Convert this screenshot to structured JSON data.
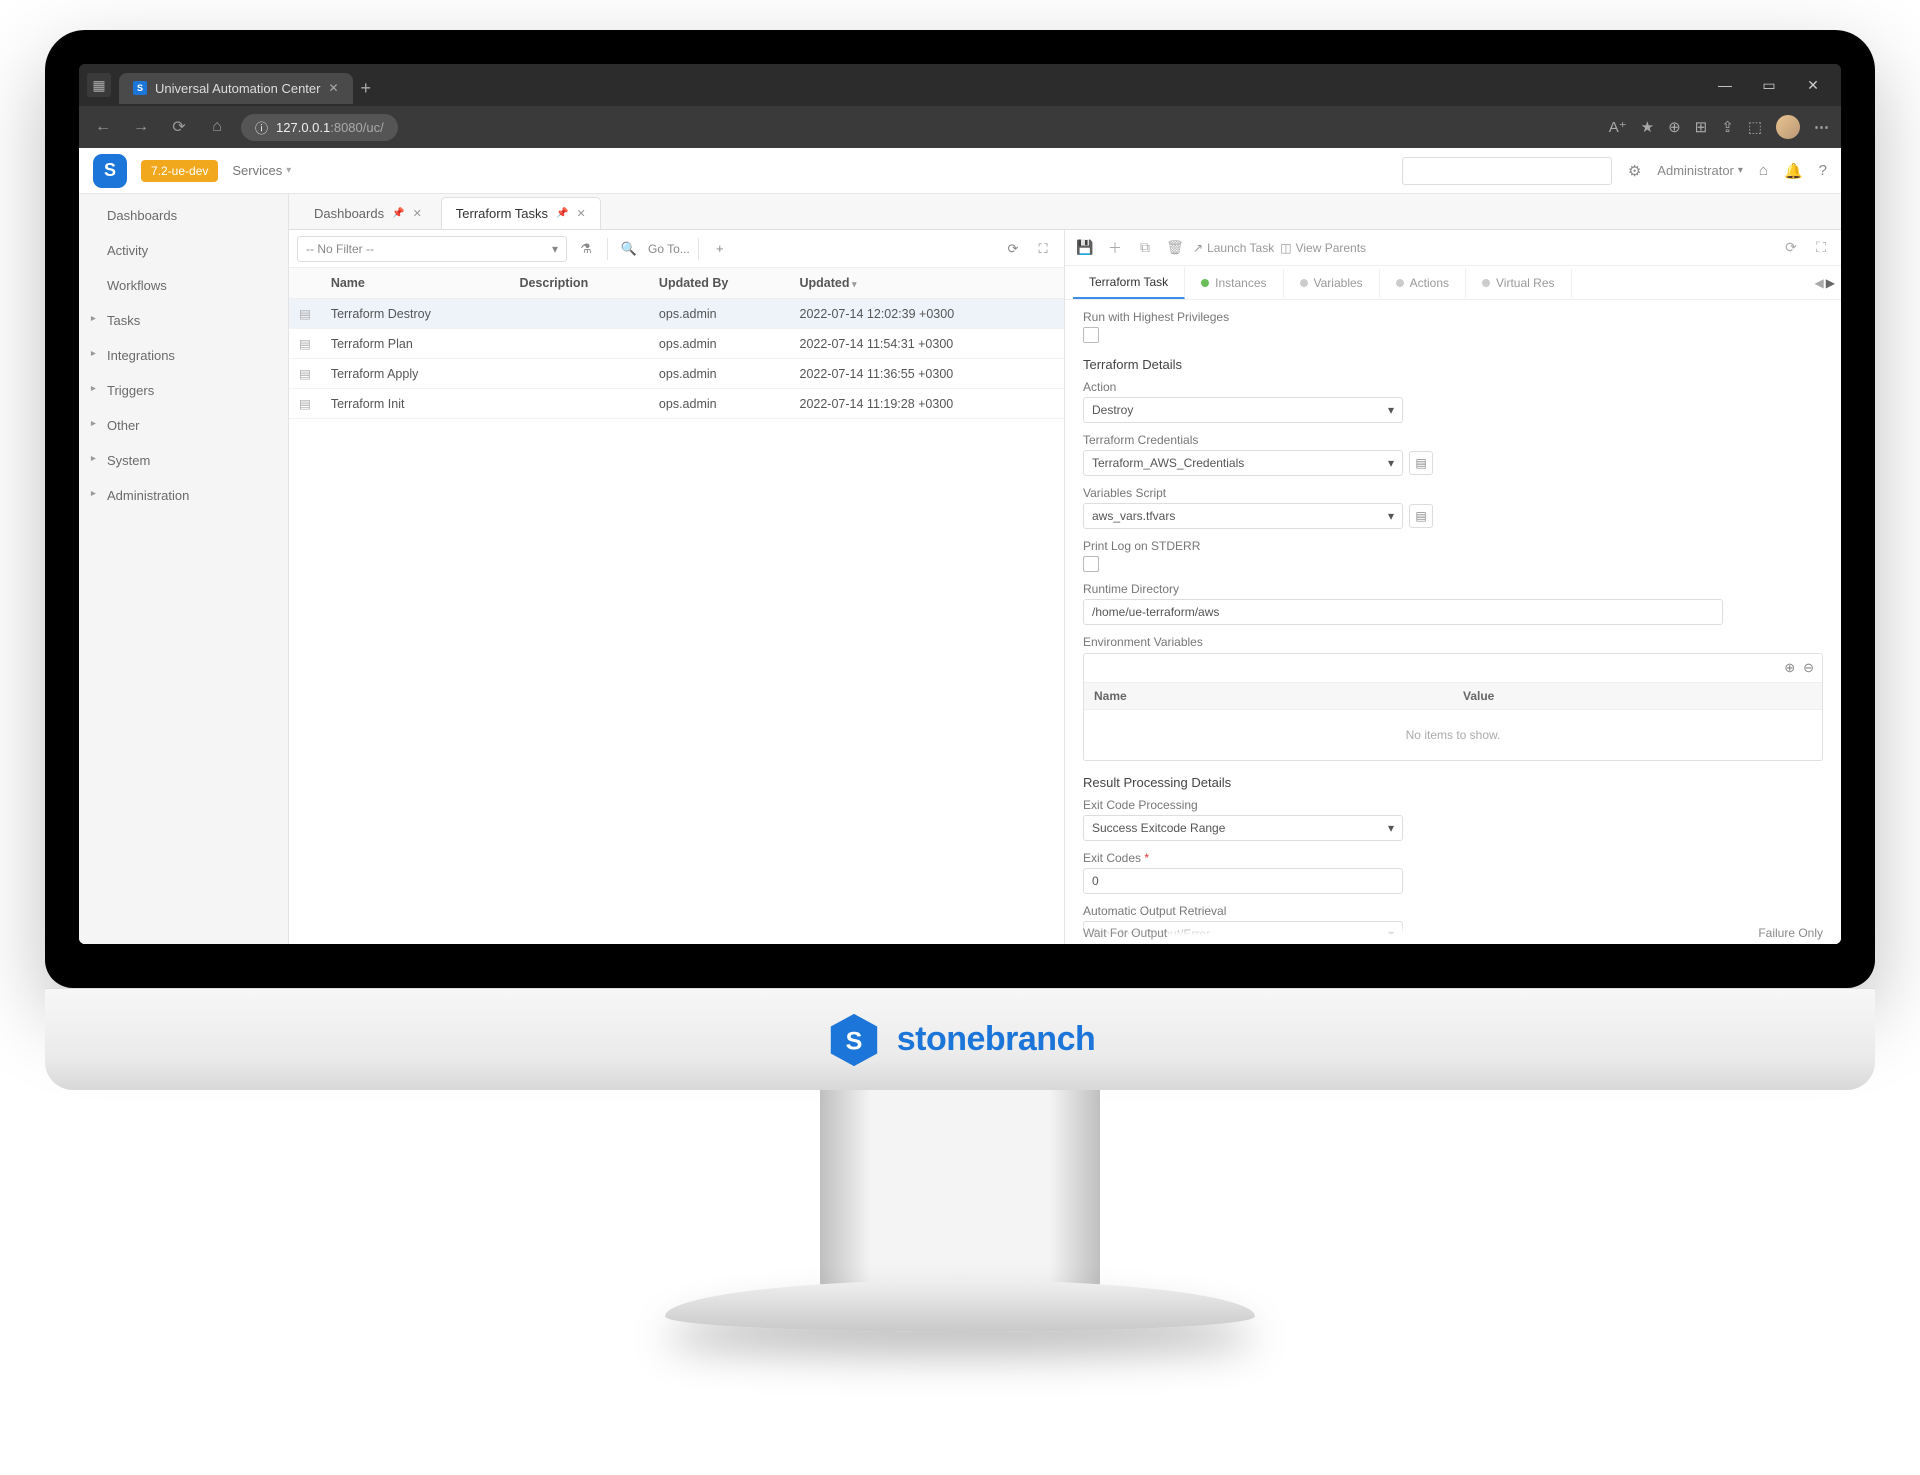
{
  "browser": {
    "tab_title": "Universal Automation Center",
    "url_prefix": "127.0.0.1",
    "url_suffix": ":8080/uc/"
  },
  "header": {
    "env_badge": "7.2-ue-dev",
    "services": "Services",
    "user": "Administrator"
  },
  "sidebar": {
    "items": [
      {
        "label": "Dashboards",
        "collapsible": false
      },
      {
        "label": "Activity",
        "collapsible": false
      },
      {
        "label": "Workflows",
        "collapsible": false
      },
      {
        "label": "Tasks",
        "collapsible": true
      },
      {
        "label": "Integrations",
        "collapsible": true
      },
      {
        "label": "Triggers",
        "collapsible": true
      },
      {
        "label": "Other",
        "collapsible": true
      },
      {
        "label": "System",
        "collapsible": true
      },
      {
        "label": "Administration",
        "collapsible": true
      }
    ]
  },
  "main_tabs": [
    {
      "label": "Dashboards",
      "active": false
    },
    {
      "label": "Terraform Tasks",
      "active": true
    }
  ],
  "list": {
    "filter_placeholder": "-- No Filter --",
    "goto": "Go To...",
    "columns": [
      "Name",
      "Description",
      "Updated By",
      "Updated"
    ],
    "sorted_col": "Updated",
    "rows": [
      {
        "name": "Terraform Destroy",
        "desc": "",
        "by": "ops.admin",
        "updated": "2022-07-14 12:02:39 +0300",
        "selected": true
      },
      {
        "name": "Terraform Plan",
        "desc": "",
        "by": "ops.admin",
        "updated": "2022-07-14 11:54:31 +0300",
        "selected": false
      },
      {
        "name": "Terraform Apply",
        "desc": "",
        "by": "ops.admin",
        "updated": "2022-07-14 11:36:55 +0300",
        "selected": false
      },
      {
        "name": "Terraform Init",
        "desc": "",
        "by": "ops.admin",
        "updated": "2022-07-14 11:19:28 +0300",
        "selected": false
      }
    ]
  },
  "detail": {
    "toolbar": {
      "launch": "Launch Task",
      "parents": "View Parents"
    },
    "tabs": [
      "Terraform Task",
      "Instances",
      "Variables",
      "Actions",
      "Virtual Res"
    ],
    "run_with": "Run with Highest Privileges",
    "section1": "Terraform Details",
    "action_label": "Action",
    "action_value": "Destroy",
    "cred_label": "Terraform Credentials",
    "cred_value": "Terraform_AWS_Credentials",
    "varscript_label": "Variables Script",
    "varscript_value": "aws_vars.tfvars",
    "printlog_label": "Print Log on STDERR",
    "runtime_label": "Runtime Directory",
    "runtime_value": "/home/ue-terraform/aws",
    "envvars_label": "Environment Variables",
    "envvars_cols": {
      "name": "Name",
      "value": "Value"
    },
    "envvars_empty": "No items to show.",
    "section2": "Result Processing Details",
    "exitproc_label": "Exit Code Processing",
    "exitproc_value": "Success Exitcode Range",
    "exitcodes_label": "Exit Codes",
    "exitcodes_value": "0",
    "autoout_label": "Automatic Output Retrieval",
    "autoout_value": "Standard Output/Error",
    "wait_label": "Wait For Output",
    "fail_label": "Failure Only"
  },
  "brand": "stonebranch"
}
